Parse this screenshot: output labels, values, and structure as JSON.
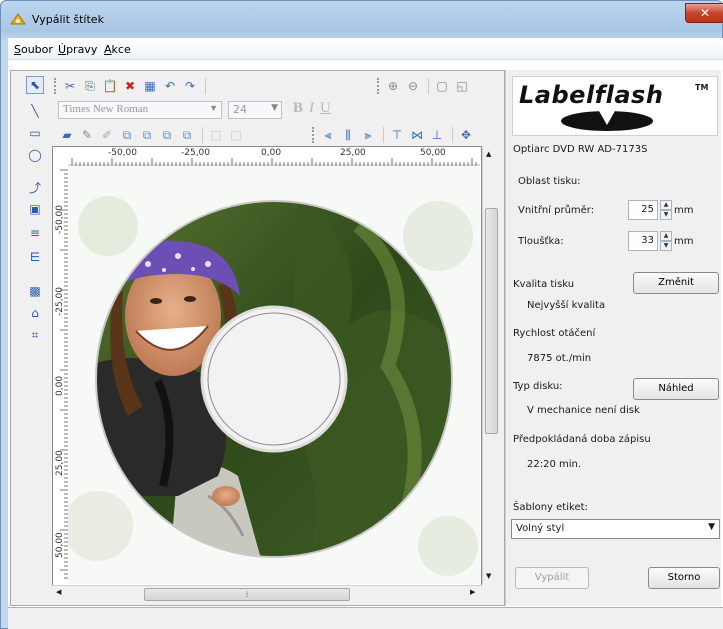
{
  "window": {
    "title": "Vypálit štítek",
    "close_label": "✕"
  },
  "menu": {
    "items": [
      "Soubor",
      "Úpravy",
      "Akce"
    ]
  },
  "toolbar": {
    "font_name": "Times New Roman",
    "font_size": "24",
    "bold": "B",
    "italic": "I",
    "underline": "U"
  },
  "ruler": {
    "h_labels": [
      "-50,00",
      "-25,00",
      "0,00",
      "25,00",
      "50,00"
    ],
    "v_labels": [
      "-50,00",
      "-25,00",
      "0,00",
      "25,00",
      "50,00"
    ]
  },
  "brand": {
    "name": "Labelflash",
    "tm": "TM"
  },
  "panel": {
    "drive": "Optiarc DVD RW AD-7173S",
    "print_area": "Oblast tisku:",
    "inner_diameter_label": "Vnitřní průměr:",
    "inner_diameter_value": "25",
    "thickness_label": "Tloušťka:",
    "thickness_value": "33",
    "unit": "mm",
    "quality_label": "Kvalita tisku",
    "quality_value": "Nejvyšší kvalita",
    "change_button": "Změnit",
    "speed_label": "Rychlost otáčení",
    "speed_value": "7875 ot./min",
    "disc_type_label": "Typ disku:",
    "disc_type_value": "V mechanice není disk",
    "preview_button": "Náhled",
    "time_label": "Předpokládaná doba zápisu",
    "time_value": "22:20 min.",
    "templates_label": "Šablony etiket:",
    "template_selected": "Volný styl",
    "burn_button": "Vypálit",
    "cancel_button": "Storno"
  },
  "colors": {
    "accent": "#3a6cb5",
    "close": "#c6452c",
    "bandana": "#6b4fb5",
    "foliage": "#3f5a26"
  }
}
